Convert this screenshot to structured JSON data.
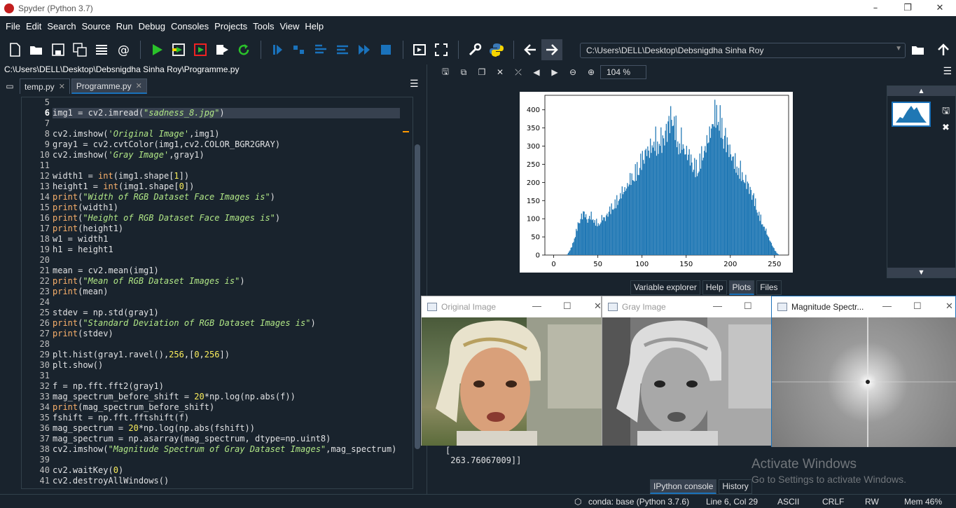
{
  "window": {
    "title": "Spyder (Python 3.7)",
    "minimize": "–",
    "restore": "❐",
    "close": "✕"
  },
  "menu": [
    "File",
    "Edit",
    "Search",
    "Source",
    "Run",
    "Debug",
    "Consoles",
    "Projects",
    "Tools",
    "View",
    "Help"
  ],
  "toolbar": {
    "working_dir": "C:\\Users\\DELL\\Desktop\\Debsnigdha Sinha Roy"
  },
  "editor": {
    "file_path": "C:\\Users\\DELL\\Desktop\\Debsnigdha Sinha Roy\\Programme.py",
    "tabs": [
      {
        "label": "temp.py"
      },
      {
        "label": "Programme.py"
      }
    ],
    "current_line": 6,
    "lines": [
      {
        "n": "5",
        "html": ""
      },
      {
        "n": "6",
        "html": "img1 = cv2.imread(<span class=\"str\">\"sadness_8.jpg\"</span>)"
      },
      {
        "n": "7",
        "html": ""
      },
      {
        "n": "8",
        "html": "cv2.imshow(<span class=\"str\">'Original Image'</span>,img1)"
      },
      {
        "n": "9",
        "html": "gray1 = cv2.cvtColor(img1,cv2.COLOR_BGR2GRAY)"
      },
      {
        "n": "10",
        "html": "cv2.imshow(<span class=\"str\">'Gray Image'</span>,gray1)"
      },
      {
        "n": "11",
        "html": ""
      },
      {
        "n": "12",
        "html": "width1 = <span class=\"bi\">int</span>(img1.shape[<span class=\"num\">1</span>])"
      },
      {
        "n": "13",
        "html": "height1 = <span class=\"bi\">int</span>(img1.shape[<span class=\"num\">0</span>])"
      },
      {
        "n": "14",
        "html": "<span class=\"bi\">print</span>(<span class=\"str\">\"Width of RGB Dataset Face Images is\"</span>)"
      },
      {
        "n": "15",
        "html": "<span class=\"bi\">print</span>(width1)"
      },
      {
        "n": "16",
        "html": "<span class=\"bi\">print</span>(<span class=\"str\">\"Height of RGB Dataset Face Images is\"</span>)"
      },
      {
        "n": "17",
        "html": "<span class=\"bi\">print</span>(height1)"
      },
      {
        "n": "18",
        "html": "w1 = width1"
      },
      {
        "n": "19",
        "html": "h1 = height1"
      },
      {
        "n": "20",
        "html": ""
      },
      {
        "n": "21",
        "html": "mean = cv2.mean(img1)"
      },
      {
        "n": "22",
        "html": "<span class=\"bi\">print</span>(<span class=\"str\">\"Mean of RGB Dataset Images is\"</span>)"
      },
      {
        "n": "23",
        "html": "<span class=\"bi\">print</span>(mean)"
      },
      {
        "n": "24",
        "html": ""
      },
      {
        "n": "25",
        "html": "stdev = np.std(gray1)"
      },
      {
        "n": "26",
        "html": "<span class=\"bi\">print</span>(<span class=\"str\">\"Standard Deviation of RGB Dataset Images is\"</span>)"
      },
      {
        "n": "27",
        "html": "<span class=\"bi\">print</span>(stdev)"
      },
      {
        "n": "28",
        "html": ""
      },
      {
        "n": "29",
        "html": "plt.hist(gray1.ravel(),<span class=\"num\">256</span>,[<span class=\"num\">0</span>,<span class=\"num\">256</span>])"
      },
      {
        "n": "30",
        "html": "plt.show()"
      },
      {
        "n": "31",
        "html": ""
      },
      {
        "n": "32",
        "html": "f = np.fft.fft2(gray1)"
      },
      {
        "n": "33",
        "html": "mag_spectrum_before_shift = <span class=\"num\">20</span>*np.log(np.abs(f))"
      },
      {
        "n": "34",
        "html": "<span class=\"bi\">print</span>(mag_spectrum_before_shift)"
      },
      {
        "n": "35",
        "html": "fshift = np.fft.fftshift(f)"
      },
      {
        "n": "36",
        "html": "mag_spectrum = <span class=\"num\">20</span>*np.log(np.abs(fshift))"
      },
      {
        "n": "37",
        "html": "mag_spectrum = np.asarray(mag_spectrum, dtype=np.uint8)"
      },
      {
        "n": "38",
        "html": "cv2.imshow(<span class=\"str\">\"Magnitude Spectrum of Gray Dataset Images\"</span>,mag_spectrum)"
      },
      {
        "n": "39",
        "html": ""
      },
      {
        "n": "40",
        "html": "cv2.waitKey(<span class=\"num\">0</span>)"
      },
      {
        "n": "41",
        "html": "cv2.destroyAllWindows()"
      }
    ]
  },
  "plots": {
    "zoom": "104 %",
    "pane_tabs": [
      "Variable explorer",
      "Help",
      "Plots",
      "Files"
    ],
    "active_tab": "Plots"
  },
  "chart_data": {
    "type": "bar",
    "title": "",
    "xlabel": "",
    "ylabel": "",
    "xlim": [
      -10,
      266
    ],
    "ylim": [
      0,
      440
    ],
    "xticks": [
      0,
      50,
      100,
      150,
      200,
      250
    ],
    "yticks": [
      0,
      50,
      100,
      150,
      200,
      250,
      300,
      350,
      400
    ],
    "color": "#1f77b4",
    "envelope_x": [
      0,
      15,
      20,
      25,
      28,
      32,
      35,
      38,
      42,
      45,
      48,
      52,
      55,
      58,
      62,
      65,
      68,
      72,
      75,
      78,
      82,
      85,
      88,
      92,
      95,
      98,
      102,
      105,
      108,
      112,
      115,
      118,
      120,
      123,
      126,
      128,
      130,
      132,
      134,
      136,
      138,
      140,
      142,
      145,
      148,
      152,
      155,
      158,
      162,
      165,
      168,
      172,
      175,
      178,
      180,
      183,
      186,
      188,
      190,
      192,
      194,
      196,
      198,
      200,
      203,
      206,
      210,
      213,
      216,
      220,
      223,
      226,
      230,
      233,
      236,
      240,
      243,
      246,
      250,
      253,
      256
    ],
    "envelope_y": [
      0,
      0,
      20,
      60,
      90,
      110,
      120,
      95,
      110,
      100,
      90,
      85,
      105,
      100,
      120,
      130,
      140,
      150,
      165,
      175,
      185,
      200,
      215,
      225,
      240,
      260,
      270,
      295,
      285,
      310,
      320,
      300,
      330,
      310,
      340,
      350,
      365,
      380,
      390,
      370,
      350,
      330,
      300,
      320,
      290,
      280,
      270,
      250,
      240,
      260,
      275,
      300,
      320,
      345,
      370,
      390,
      400,
      380,
      360,
      330,
      340,
      310,
      300,
      285,
      270,
      250,
      240,
      225,
      210,
      195,
      180,
      165,
      130,
      110,
      90,
      70,
      50,
      35,
      15,
      5,
      0
    ]
  },
  "console": {
    "output_lines": [
      "[",
      " 263.76067009]]"
    ],
    "tabs": [
      "IPython console",
      "History"
    ],
    "active_tab": "IPython console"
  },
  "windows": {
    "original": {
      "title": "Original Image"
    },
    "gray": {
      "title": "Gray Image"
    },
    "magnitude": {
      "title": "Magnitude Spectr..."
    }
  },
  "watermark": {
    "line1": "Activate Windows",
    "line2": "Go to Settings to activate Windows."
  },
  "status": {
    "env": "conda: base (Python 3.7.6)",
    "position": "Line 6, Col 29",
    "encoding": "ASCII",
    "eol": "CRLF",
    "perm": "RW",
    "mem": "Mem 46%"
  }
}
